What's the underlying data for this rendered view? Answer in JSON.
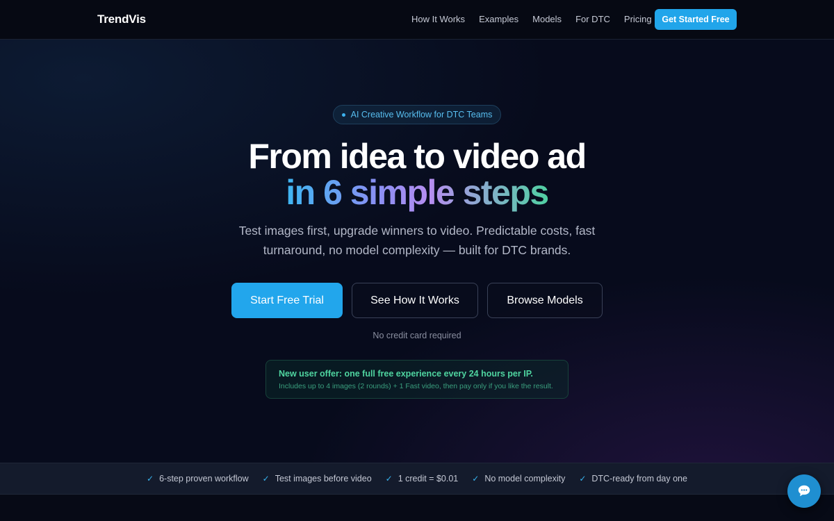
{
  "nav": {
    "brand": "TrendVis",
    "links": [
      "How It Works",
      "Examples",
      "Models",
      "For DTC",
      "Pricing"
    ],
    "cta": "Get Started Free"
  },
  "hero": {
    "badge": "AI Creative Workflow for DTC Teams",
    "title_line1": "From idea to video ad",
    "title_line2": "in 6 simple steps",
    "subtitle": "Test images first, upgrade winners to video. Predictable costs, fast turnaround, no model complexity — built for DTC brands.",
    "buttons": {
      "primary": "Start Free Trial",
      "how": "See How It Works",
      "models": "Browse Models"
    },
    "note": "No credit card required",
    "offer": {
      "title": "New user offer: one full free experience every 24 hours per IP.",
      "description": "Includes up to 4 images (2 rounds) + 1 Fast video, then pay only if you like the result."
    }
  },
  "features": [
    "6-step proven workflow",
    "Test images before video",
    "1 credit = $0.01",
    "No model complexity",
    "DTC-ready from day one"
  ],
  "icons": {
    "check": "check-icon",
    "badge_dot": "dot-icon",
    "chat": "chat-bubble-icon"
  },
  "colors": {
    "accent": "#22a6ec",
    "background": "#070b1c",
    "offer_text": "#4fd4a0"
  }
}
